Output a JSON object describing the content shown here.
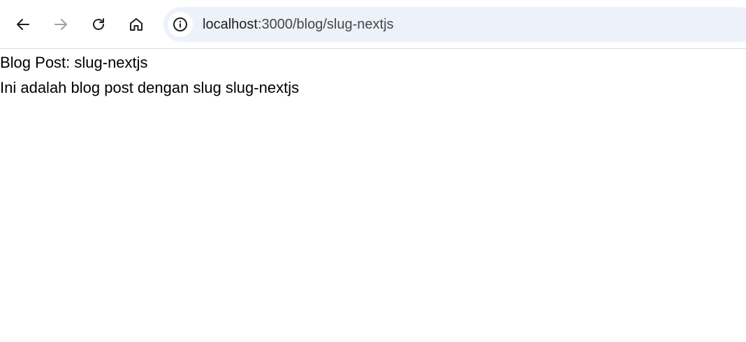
{
  "browser": {
    "back_icon": "arrow-left-icon",
    "forward_icon": "arrow-right-icon",
    "reload_icon": "reload-icon",
    "home_icon": "home-icon",
    "site_info_icon": "info-icon",
    "url_host": "localhost",
    "url_path": ":3000/blog/slug-nextjs",
    "omnibox_bg": "#edf2fa"
  },
  "page": {
    "title": "Blog Post: slug-nextjs",
    "body": "Ini adalah blog post dengan slug slug-nextjs"
  }
}
